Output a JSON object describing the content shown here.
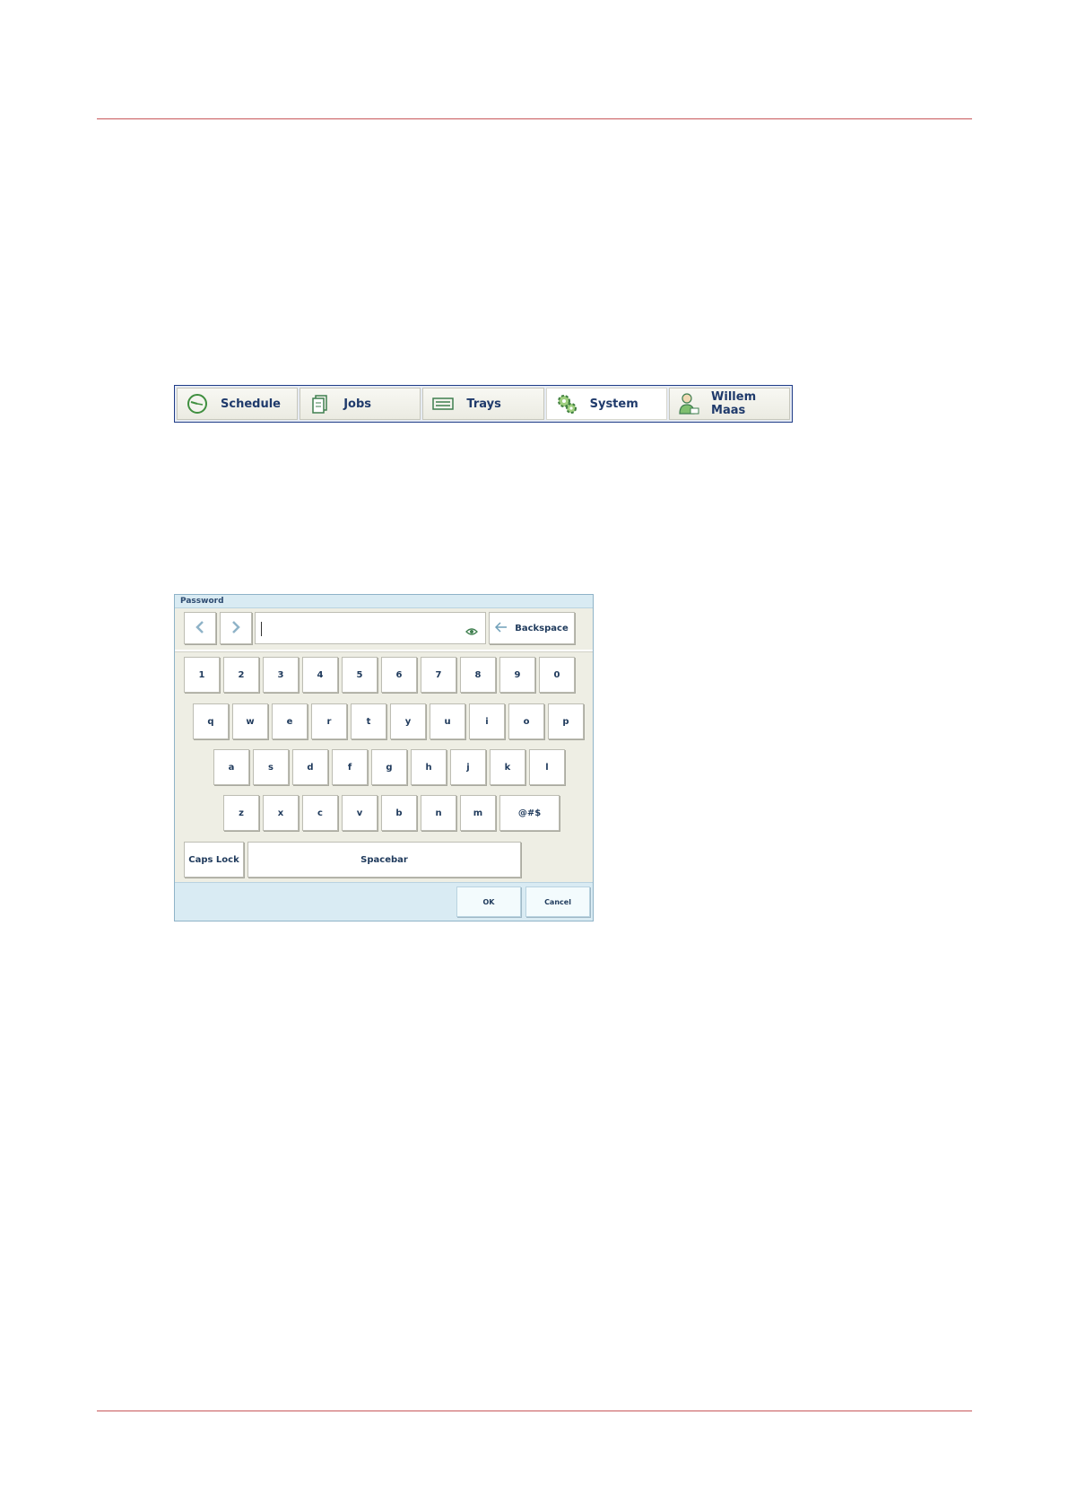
{
  "tabs": [
    {
      "label": "Schedule",
      "icon": "clock-icon",
      "active": false
    },
    {
      "label": "Jobs",
      "icon": "jobs-icon",
      "active": false
    },
    {
      "label": "Trays",
      "icon": "trays-icon",
      "active": false
    },
    {
      "label": "System",
      "icon": "gears-icon",
      "active": true
    },
    {
      "label": "Willem Maas",
      "icon": "user-icon",
      "active": false
    }
  ],
  "dialog": {
    "title": "Password",
    "input_value": "",
    "backspace_label": "Backspace",
    "rows": {
      "numbers": [
        "1",
        "2",
        "3",
        "4",
        "5",
        "6",
        "7",
        "8",
        "9",
        "0"
      ],
      "top": [
        "q",
        "w",
        "e",
        "r",
        "t",
        "y",
        "u",
        "i",
        "o",
        "p"
      ],
      "middle": [
        "a",
        "s",
        "d",
        "f",
        "g",
        "h",
        "j",
        "k",
        "l"
      ],
      "bottom": [
        "z",
        "x",
        "c",
        "v",
        "b",
        "n",
        "m"
      ]
    },
    "symbols_label": "@#$",
    "caps_lock_label": "Caps Lock",
    "spacebar_label": "Spacebar",
    "ok_label": "OK",
    "cancel_label": "Cancel"
  },
  "colors": {
    "rule": "#c8575a",
    "tab_border": "#1f3c88",
    "dialog_header": "#d9ebf3"
  }
}
